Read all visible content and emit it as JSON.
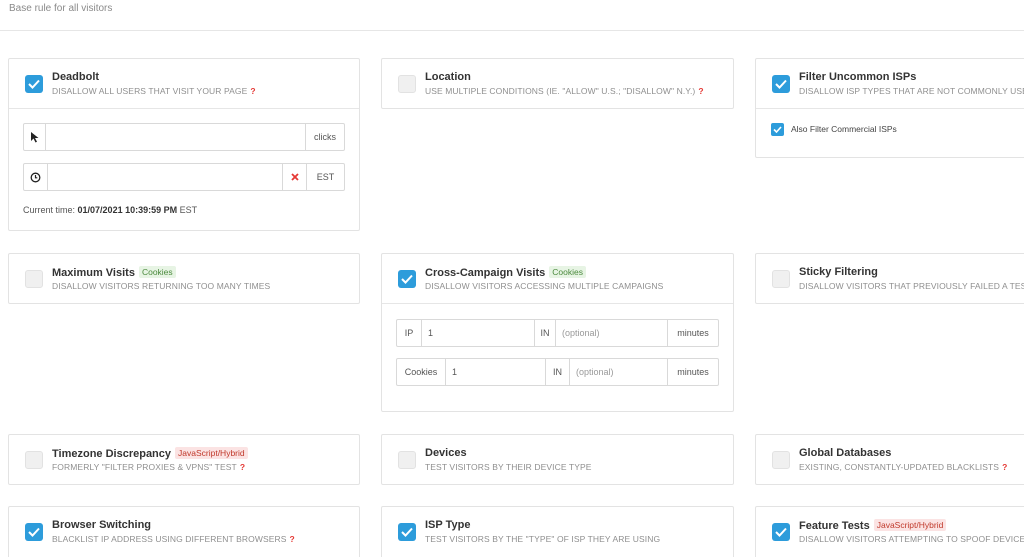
{
  "header": {
    "subtitle": "Base rule for all visitors"
  },
  "colors": {
    "accent": "#2d9cdb",
    "question": "#e53935",
    "badge_cookies": "#4c8a3e",
    "badge_js": "#c0392b"
  },
  "cards": {
    "deadbolt": {
      "title": "Deadbolt",
      "desc": "DISALLOW ALL USERS THAT VISIT YOUR PAGE",
      "checked": true,
      "clicks_value": "",
      "clicks_suffix": "clicks",
      "time_value": "",
      "tz": "EST",
      "current_time_label": "Current time:",
      "current_time_value": "01/07/2021 10:39:59 PM",
      "current_time_tz": "EST"
    },
    "location": {
      "title": "Location",
      "desc": "USE MULTIPLE CONDITIONS (IE. \"ALLOW\" U.S.; \"DISALLOW\" N.Y.)",
      "checked": false
    },
    "filter_isps": {
      "title": "Filter Uncommon ISPs",
      "desc": "DISALLOW ISP TYPES THAT ARE NOT COMMONLY USED",
      "checked": true,
      "sub_option": "Also Filter Commercial ISPs",
      "sub_checked": true
    },
    "max_visits": {
      "title": "Maximum Visits",
      "badge": "Cookies",
      "desc": "DISALLOW VISITORS RETURNING TOO MANY TIMES",
      "checked": false
    },
    "cross_campaign": {
      "title": "Cross-Campaign Visits",
      "badge": "Cookies",
      "desc": "DISALLOW VISITORS ACCESSING MULTIPLE CAMPAIGNS",
      "checked": true,
      "rows": [
        {
          "label": "IP",
          "value": "1",
          "in_label": "IN",
          "placeholder": "(optional)",
          "unit": "minutes"
        },
        {
          "label": "Cookies",
          "value": "1",
          "in_label": "IN",
          "placeholder": "(optional)",
          "unit": "minutes"
        }
      ]
    },
    "sticky": {
      "title": "Sticky Filtering",
      "desc": "DISALLOW VISITORS THAT PREVIOUSLY FAILED A TEST",
      "checked": false
    },
    "timezone": {
      "title": "Timezone Discrepancy",
      "badge": "JavaScript/Hybrid",
      "desc": "FORMERLY \"FILTER PROXIES & VPNS\" TEST",
      "checked": false
    },
    "devices": {
      "title": "Devices",
      "desc": "TEST VISITORS BY THEIR DEVICE TYPE",
      "checked": false
    },
    "global_db": {
      "title": "Global Databases",
      "desc": "EXISTING, CONSTANTLY-UPDATED BLACKLISTS",
      "checked": false
    },
    "browser_switch": {
      "title": "Browser Switching",
      "desc": "BLACKLIST IP ADDRESS USING DIFFERENT BROWSERS",
      "checked": true
    },
    "isp_type": {
      "title": "ISP Type",
      "desc": "TEST VISITORS BY THE \"TYPE\" OF ISP THEY ARE USING",
      "checked": true
    },
    "feature_tests": {
      "title": "Feature Tests",
      "badge": "JavaScript/Hybrid",
      "desc": "DISALLOW VISITORS ATTEMPTING TO SPOOF DEVICES",
      "checked": true
    }
  },
  "icons": {
    "checkmark": "check-icon",
    "cursor": "cursor-icon",
    "clock": "clock-icon",
    "clear": "close-icon",
    "help": "question-icon"
  }
}
